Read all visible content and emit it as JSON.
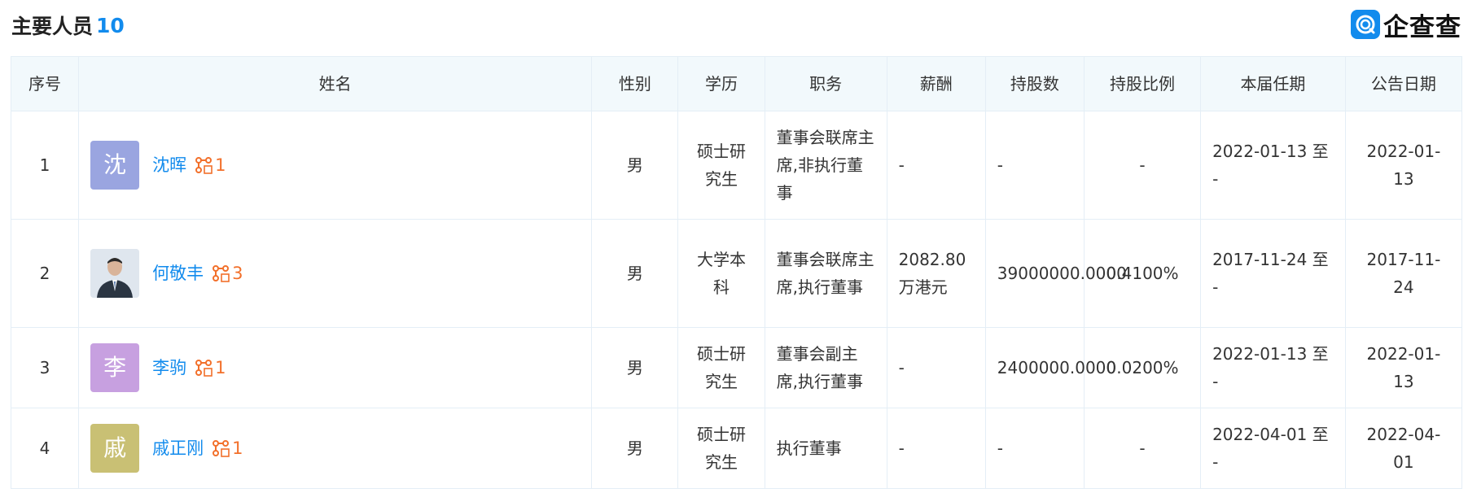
{
  "header": {
    "title": "主要人员",
    "count": "10"
  },
  "logo": {
    "text": "企查查"
  },
  "colors": {
    "accent": "#128bed",
    "badge": "#f2702b",
    "header_bg": "#f2f9fc"
  },
  "table": {
    "columns": [
      "序号",
      "姓名",
      "性别",
      "学历",
      "职务",
      "薪酬",
      "持股数",
      "持股比例",
      "本届任期",
      "公告日期"
    ],
    "rows": [
      {
        "index": "1",
        "avatar_char": "沈",
        "avatar_color": "#9aa5e0",
        "name": "沈晖",
        "relation_count": "1",
        "gender": "男",
        "education": "硕士研究生",
        "position": "董事会联席主席,非执行董事",
        "salary": "-",
        "shares": "-",
        "share_ratio": "-",
        "term": "2022-01-13 至 -",
        "announce_date": "2022-01-13"
      },
      {
        "index": "2",
        "avatar_char": "",
        "avatar_color": "#dfe6ee",
        "name": "何敬丰",
        "relation_count": "3",
        "gender": "男",
        "education": "大学本科",
        "position": "董事会联席主席,执行董事",
        "salary": "2082.80万港元",
        "shares": "39000000.0000",
        "share_ratio": "0.4100%",
        "term": "2017-11-24 至 -",
        "announce_date": "2017-11-24"
      },
      {
        "index": "3",
        "avatar_char": "李",
        "avatar_color": "#c7a0e0",
        "name": "李驹",
        "relation_count": "1",
        "gender": "男",
        "education": "硕士研究生",
        "position": "董事会副主席,执行董事",
        "salary": "-",
        "shares": "2400000.0000",
        "share_ratio": "0.0200%",
        "term": "2022-01-13 至 -",
        "announce_date": "2022-01-13"
      },
      {
        "index": "4",
        "avatar_char": "戚",
        "avatar_color": "#c9c074",
        "name": "戚正刚",
        "relation_count": "1",
        "gender": "男",
        "education": "硕士研究生",
        "position": "执行董事",
        "salary": "-",
        "shares": "-",
        "share_ratio": "-",
        "term": "2022-04-01 至 -",
        "announce_date": "2022-04-01"
      }
    ]
  }
}
